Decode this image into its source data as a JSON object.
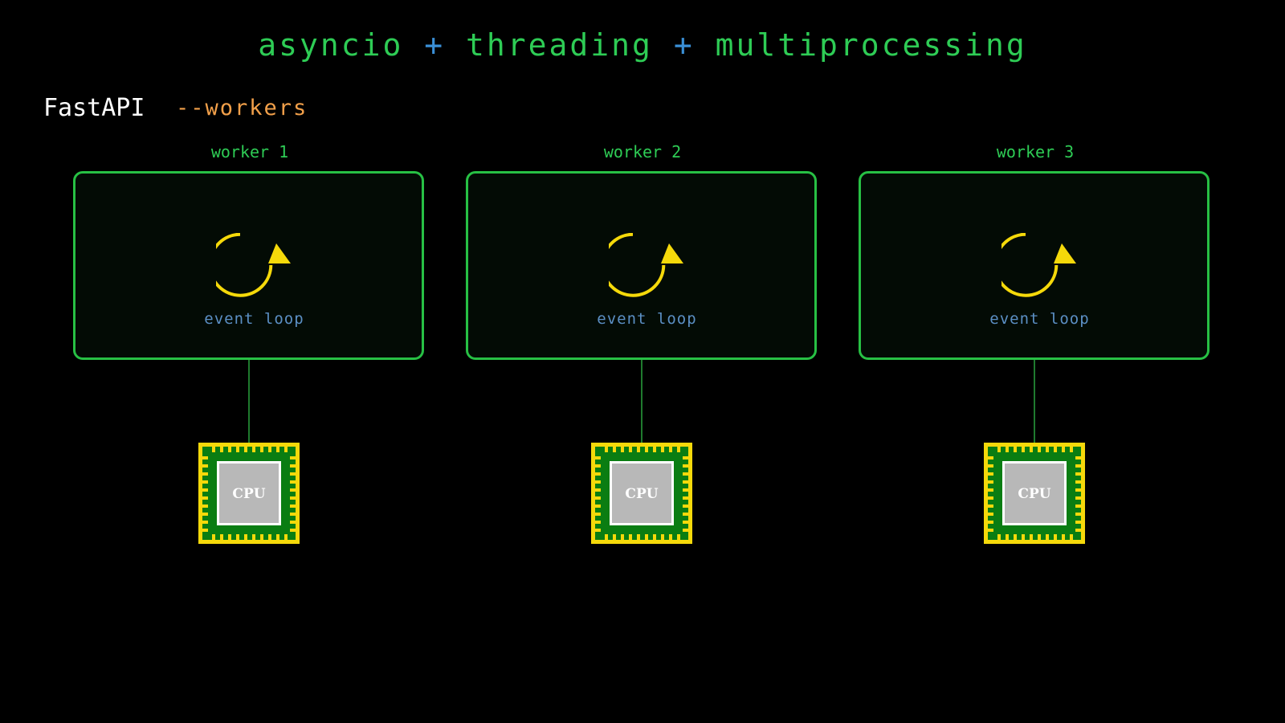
{
  "title": {
    "part1": "asyncio",
    "plus1": "+",
    "part2": "threading",
    "plus2": "+",
    "part3": "multiprocessing"
  },
  "app": {
    "name": "FastAPI",
    "flag": "--workers"
  },
  "workers": [
    {
      "label": "worker 1",
      "loop_label": "event loop",
      "cpu_label": "CPU"
    },
    {
      "label": "worker 2",
      "loop_label": "event loop",
      "cpu_label": "CPU"
    },
    {
      "label": "worker 3",
      "loop_label": "event loop",
      "cpu_label": "CPU"
    }
  ],
  "colors": {
    "background": "#000000",
    "accent_green": "#2ecc55",
    "plus_blue": "#3a8fd6",
    "flag_orange": "#f2a04a",
    "loop_yellow": "#f5d90a",
    "loop_text_blue": "#5b8fc4",
    "cpu_green": "#0a7d12",
    "cpu_core_gray": "#b8b8b8"
  },
  "icons": {
    "loop": "circular-arrow-icon",
    "cpu": "cpu-chip-icon"
  }
}
